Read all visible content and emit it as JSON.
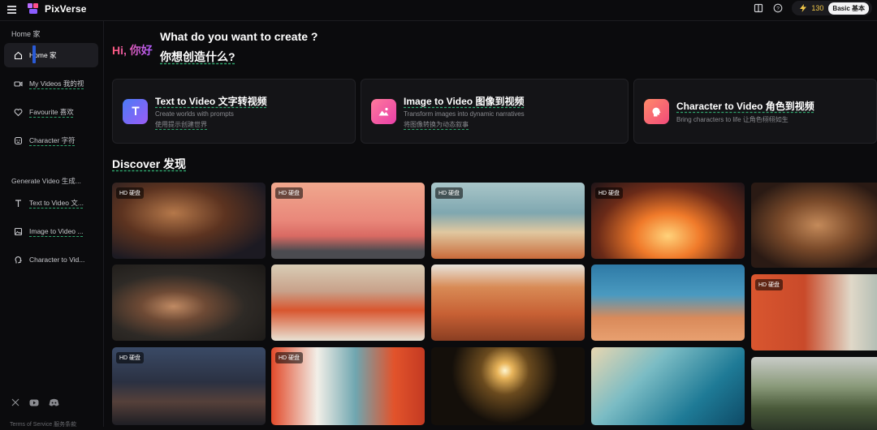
{
  "app": {
    "name": "PixVerse"
  },
  "topbar": {
    "credits": "130",
    "plan": "Basic 基本"
  },
  "sidebar": {
    "home_section": "Home 家",
    "items": [
      {
        "label": "Home 家",
        "icon": "home-icon"
      },
      {
        "label": "My Videos 我的视",
        "icon": "video-camera-icon"
      },
      {
        "label": "Favourite 喜欢",
        "icon": "heart-icon"
      },
      {
        "label": "Character 字符",
        "icon": "character-face-icon"
      }
    ],
    "generate_section": "Generate Video 生成...",
    "gen_items": [
      {
        "label": "Text to Video 文...",
        "icon": "text-t-icon"
      },
      {
        "label": "Image to Video ...",
        "icon": "image-icon"
      },
      {
        "label": "Character to Vid...",
        "icon": "character-head-icon"
      }
    ],
    "footer": {
      "terms": "Terms of Service 服务条款"
    }
  },
  "main": {
    "greeting": "Hi, 你好",
    "question_en": "What do you want to create ?",
    "question_zh": "你想创造什么?",
    "cards": [
      {
        "title": "Text to Video 文字转视频",
        "subtitle": "Create worlds with prompts",
        "subtitle_zh": "使用提示创建世界",
        "icon": "text-t-icon",
        "color": "#6b63f5"
      },
      {
        "title": "Image to Video 图像到视频",
        "subtitle": "Transform images into dynamic narratives",
        "subtitle_zh": "将图像转换为动态叙事",
        "icon": "image-icon",
        "color": "#f25b9a"
      },
      {
        "title": "Character to Video 角色到视频",
        "subtitle": "Bring characters to life 让角色栩栩如生",
        "subtitle_zh": "",
        "icon": "character-head-icon",
        "color": "#f26a5a"
      }
    ],
    "discover": "Discover 发现",
    "hd_badge": "HD 硬盘"
  }
}
